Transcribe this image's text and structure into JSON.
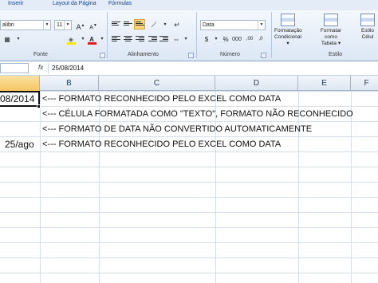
{
  "ribbon": {
    "tabs": [
      "Inserir",
      "Layout da Página",
      "Fórmulas"
    ],
    "font_name": "alibri",
    "font_size": "11",
    "number_format": "Data",
    "groups": {
      "font": "Fonte",
      "alignment": "Alinhamento",
      "number": "Número",
      "style": "Estilo"
    },
    "buttons": {
      "conditional_formatting": [
        "Formatação",
        "Condicional ▾"
      ],
      "format_as_table": [
        "Formatar",
        "como Tabela ▾"
      ],
      "cell_styles": [
        "Estilo",
        "Célul"
      ]
    }
  },
  "formula_bar": {
    "fx_label": "fx",
    "value": "25/08/2014"
  },
  "columns": [
    "B",
    "C",
    "D",
    "E",
    "F"
  ],
  "cells": {
    "a1": "08/2014",
    "a4": "25/ago",
    "b1": "<--- FORMATO RECONHECIDO PELO EXCEL COMO DATA",
    "b2": "<--- CÉLULA FORMATADA COMO \"TEXTO\", FORMATO NÃO RECONHECIDO",
    "b3": "<--- FORMATO DE DATA NÃO CONVERTIDO AUTOMATICAMENTE",
    "b4": "<--- FORMATO RECONHECIDO PELO EXCEL COMO DATA"
  },
  "colors": {
    "ribbon_bg": "#dce7f5",
    "selected_header": "#f4c660",
    "highlight_button": "#fbd577"
  }
}
